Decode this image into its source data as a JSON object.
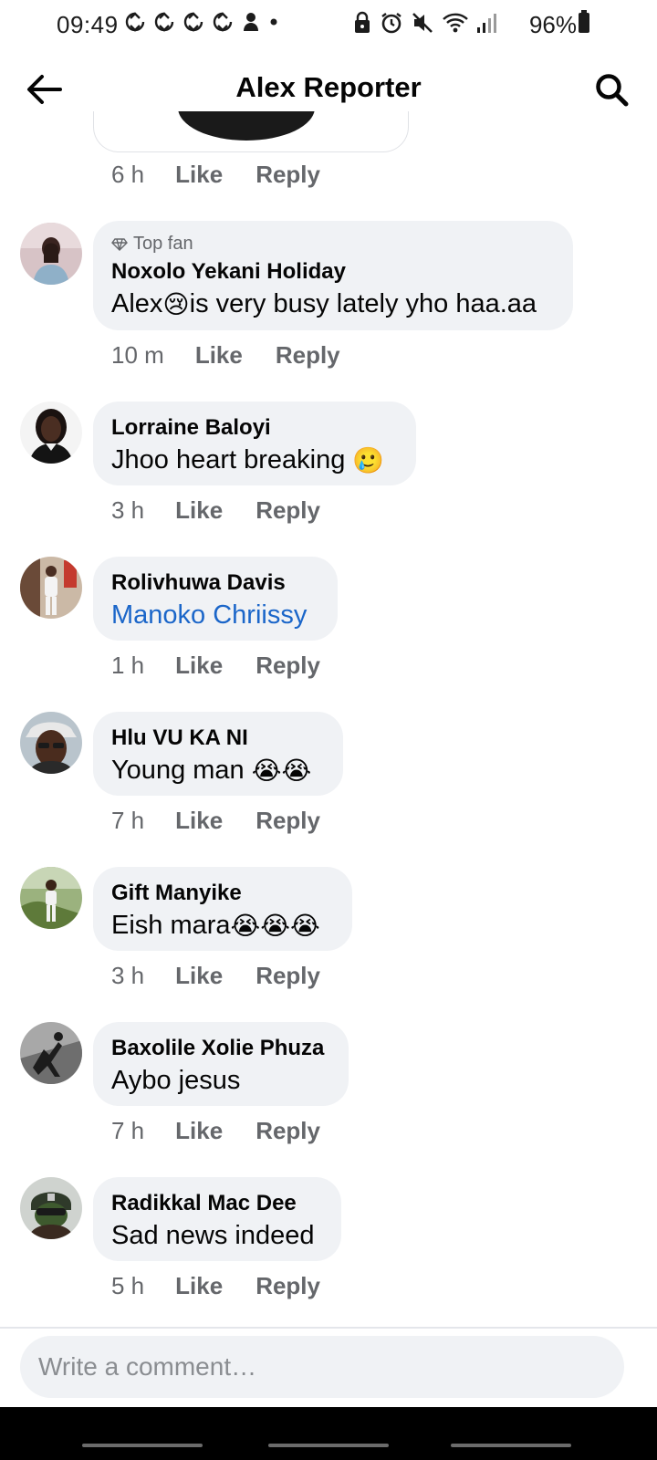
{
  "status_bar": {
    "time": "09:49",
    "battery": "96%",
    "left_icons": [
      "sync-icon",
      "sync-icon",
      "sync-icon",
      "sync-icon",
      "notification-icon",
      "dot-icon"
    ],
    "right_icons": [
      "lock-icon",
      "alarm-icon",
      "mute-icon",
      "wifi-icon",
      "signal-icon"
    ]
  },
  "header": {
    "title": "Alex Reporter"
  },
  "previous_comment": {
    "time": "6 h",
    "like": "Like",
    "reply": "Reply"
  },
  "comments": [
    {
      "badge": "Top fan",
      "author": "Noxolo Yekani Holiday",
      "text_before": "Alex",
      "emoji": "😢",
      "text_after": "is very busy lately yho haa.aa",
      "time": "10 m",
      "like": "Like",
      "reply": "Reply"
    },
    {
      "author": "Lorraine Baloyi",
      "text": "Jhoo heart breaking ",
      "emoji": "🥲",
      "time": "3 h",
      "like": "Like",
      "reply": "Reply"
    },
    {
      "author": "Rolivhuwa Davis",
      "text": "Manoko Chriissy",
      "time": "1 h",
      "like": "Like",
      "reply": "Reply"
    },
    {
      "author": "Hlu VU KA NI",
      "text": "Young man ",
      "emoji": "😭😭",
      "time": "7 h",
      "like": "Like",
      "reply": "Reply"
    },
    {
      "author": "Gift Manyike",
      "text": "Eish mara",
      "emoji": "😭😭😭",
      "time": "3 h",
      "like": "Like",
      "reply": "Reply"
    },
    {
      "author": "Baxolile Xolie Phuza",
      "text": "Aybo jesus",
      "time": "7 h",
      "like": "Like",
      "reply": "Reply"
    },
    {
      "author": "Radikkal Mac Dee",
      "text": "Sad news indeed",
      "time": "5 h",
      "like": "Like",
      "reply": "Reply"
    }
  ],
  "composer": {
    "placeholder": "Write a comment…"
  },
  "colors": {
    "bubble": "#f0f2f5",
    "meta_text": "#65676b",
    "link": "#1b66c9",
    "nav_bar": "#000000"
  }
}
